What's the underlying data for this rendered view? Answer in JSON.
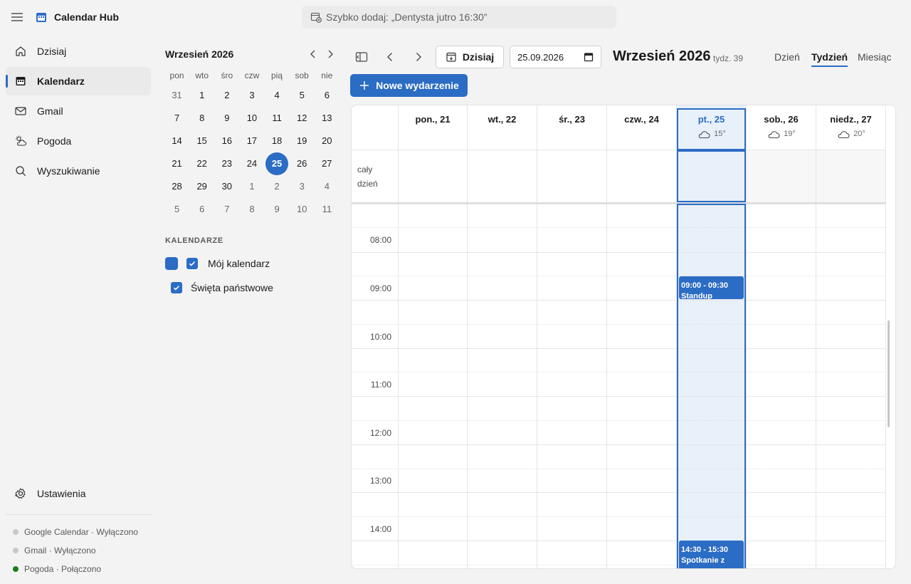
{
  "app": {
    "title": "Calendar Hub"
  },
  "quick_add": {
    "placeholder": "Szybko dodaj: „Dentysta jutro 16:30”"
  },
  "nav": {
    "items": [
      {
        "label": "Dzisiaj",
        "icon": "home-icon"
      },
      {
        "label": "Kalendarz",
        "icon": "calendar-icon",
        "active": true
      },
      {
        "label": "Gmail",
        "icon": "mail-icon"
      },
      {
        "label": "Pogoda",
        "icon": "weather-icon"
      },
      {
        "label": "Wyszukiwanie",
        "icon": "search-icon"
      }
    ],
    "settings_label": "Ustawienia"
  },
  "status": [
    {
      "text": "Google Calendar · Wyłączono",
      "connected": false
    },
    {
      "text": "Gmail · Wyłączono",
      "connected": false
    },
    {
      "text": "Pogoda · Połączono",
      "connected": true
    }
  ],
  "mini_calendar": {
    "title": "Wrzesień 2026",
    "weekdays": [
      "pon",
      "wto",
      "śro",
      "czw",
      "pią",
      "sob",
      "nie"
    ],
    "weeks": [
      [
        "31",
        "1",
        "2",
        "3",
        "4",
        "5",
        "6"
      ],
      [
        "7",
        "8",
        "9",
        "10",
        "11",
        "12",
        "13"
      ],
      [
        "14",
        "15",
        "16",
        "17",
        "18",
        "19",
        "20"
      ],
      [
        "21",
        "22",
        "23",
        "24",
        "25",
        "26",
        "27"
      ],
      [
        "28",
        "29",
        "30",
        "1",
        "2",
        "3",
        "4"
      ],
      [
        "5",
        "6",
        "7",
        "8",
        "9",
        "10",
        "11"
      ]
    ],
    "today": "25"
  },
  "calendars": {
    "heading": "KALENDARZE",
    "items": [
      {
        "label": "Mój kalendarz",
        "checked": true,
        "color": "#2b6cc4"
      },
      {
        "label": "Święta państwowe",
        "checked": true
      }
    ]
  },
  "toolbar": {
    "today_label": "Dzisiaj",
    "date_value": "25.09.2026",
    "month_title": "Wrzesień 2026",
    "week_label": "tydz. 39",
    "views": [
      "Dzień",
      "Tydzień",
      "Miesiąc"
    ],
    "active_view": "Tydzień",
    "new_event_label": "Nowe wydarzenie"
  },
  "week": {
    "days": [
      {
        "label": "pon., 21"
      },
      {
        "label": "wt., 22"
      },
      {
        "label": "śr., 23"
      },
      {
        "label": "czw., 24"
      },
      {
        "label": "pt., 25",
        "today": true,
        "temp": "15°"
      },
      {
        "label": "sob., 26",
        "temp": "19°"
      },
      {
        "label": "niedz., 27",
        "temp": "20°"
      }
    ],
    "all_day_label": "cały dzień",
    "hours": [
      "08:00",
      "09:00",
      "10:00",
      "11:00",
      "12:00",
      "13:00",
      "14:00"
    ],
    "events": [
      {
        "time": "09:00 - 09:30",
        "title": "Standup"
      },
      {
        "time": "14:30 - 15:30",
        "title": "Spotkanie z"
      }
    ]
  },
  "colors": {
    "accent": "#2b6cc4",
    "today_bg": "#e8f0fa"
  }
}
